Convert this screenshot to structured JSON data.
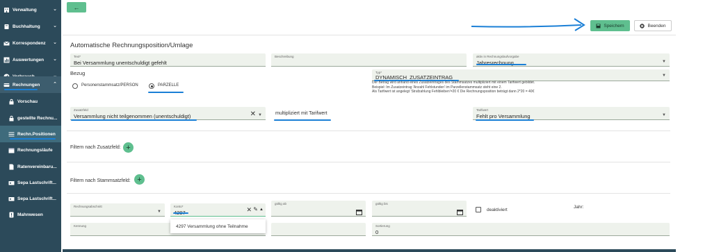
{
  "sidebar": {
    "items": [
      {
        "label": "Verwaltung",
        "icon": "building-icon",
        "chev": "⌄"
      },
      {
        "label": "Buchhaltung",
        "icon": "book-icon",
        "chev": "⌄"
      },
      {
        "label": "Korrespondenz",
        "icon": "mail-icon",
        "chev": "⌄"
      },
      {
        "label": "Auswertungen",
        "icon": "chart-icon",
        "chev": "⌄"
      },
      {
        "label": "Verbrauch",
        "icon": "gauge-icon",
        "chev": "⌄"
      },
      {
        "label": "Rechnungen",
        "icon": "invoice-icon",
        "chev": "⌃"
      }
    ],
    "sub_items": [
      {
        "label": "Vorschau",
        "icon": "lock-icon"
      },
      {
        "label": "gestellte Rechnu...",
        "icon": "lock-icon"
      },
      {
        "label": "Rechn.Positionen",
        "icon": "list-icon"
      },
      {
        "label": "Rechnungsläufe",
        "icon": "calendar-icon"
      },
      {
        "label": "Ratenvereinbaru...",
        "icon": "document-icon"
      },
      {
        "label": "Sepa Lastschrift...",
        "icon": "card-icon"
      },
      {
        "label": "Sepa Lastschrift...",
        "icon": "card-icon"
      },
      {
        "label": "Mahnwesen",
        "icon": "alert-icon"
      }
    ]
  },
  "toolbar": {
    "back_label": "←",
    "save_label": "Speichern",
    "end_label": "Beenden"
  },
  "form": {
    "title": "Automatische Rechnungsposition/Umlage",
    "text_label": "Text*",
    "text_value": "Bei Versammlung unentschuldigt gefehlt",
    "beschreibung_label": "Beschreibung",
    "beschreibung_value": "",
    "aktiv_label": "aktiv in Rechnungslaufvorgabe",
    "aktiv_value": "Jahresrechnung",
    "bezug_label": "Bezug",
    "radio_person": "Personenstammsatz/PERSON",
    "radio_parzelle": "PARZELLE",
    "radio_selected": "PARZELLE",
    "typ_label": "Typ*",
    "typ_value": "DYNAMISCH_ZUSATZEINTRAG",
    "info_line1": "Der Betrag wird anhand eines Zusatzeintrages des Stammsatzes multipliziert mit einem Tarifwert gebildet.",
    "info_line2": "Beispiel: Im Zusatzeintrag 'Anzahl Fehlstunden' im Parzellenstammsatz steht eine 2.",
    "info_line3": "Als Tarifwert ist angelegt 'Strafzahlung Fehlbleiben'=20 € Die Rechnungsposition beträgt dann 2*20 = 40€",
    "zusatzfeld_label": "Zusatzfeld",
    "zusatzfeld_value": "Versammlung nicht teilgenommen (unentschuldigt)",
    "multipliziert": "multipliziert mit Tarifwert",
    "tarifwert_label": "Tarifwert",
    "tarifwert_value": "Fehlt pro Versammlung",
    "filter_zusatz": "Filtern nach Zusatzfeld:",
    "filter_stamm": "Filtern nach Stammsatzfeld:",
    "rechnungsabschnitt_label": "Rechnungsabschnitt",
    "rechnungsabschnitt_value": "",
    "konto_label": "Konto*",
    "konto_value": "4297",
    "gueltig_ab_label": "gültig ab",
    "gueltig_bis_label": "gültig bis",
    "deaktiviert_label": "deaktiviert",
    "jahr_label": "Jahr:",
    "kennung_label": "Kennung",
    "kennung_value": "",
    "sortierung_label": "Sortierung",
    "sortierung_value": "0",
    "konto_option": "4297 Versammlung ohne Teilnahme"
  },
  "colors": {
    "sidebar_bg": "#2c4a5a",
    "accent_green": "#5fbf8f",
    "field_bg": "#eef2ec",
    "annotation_blue": "#1a7fd6"
  }
}
